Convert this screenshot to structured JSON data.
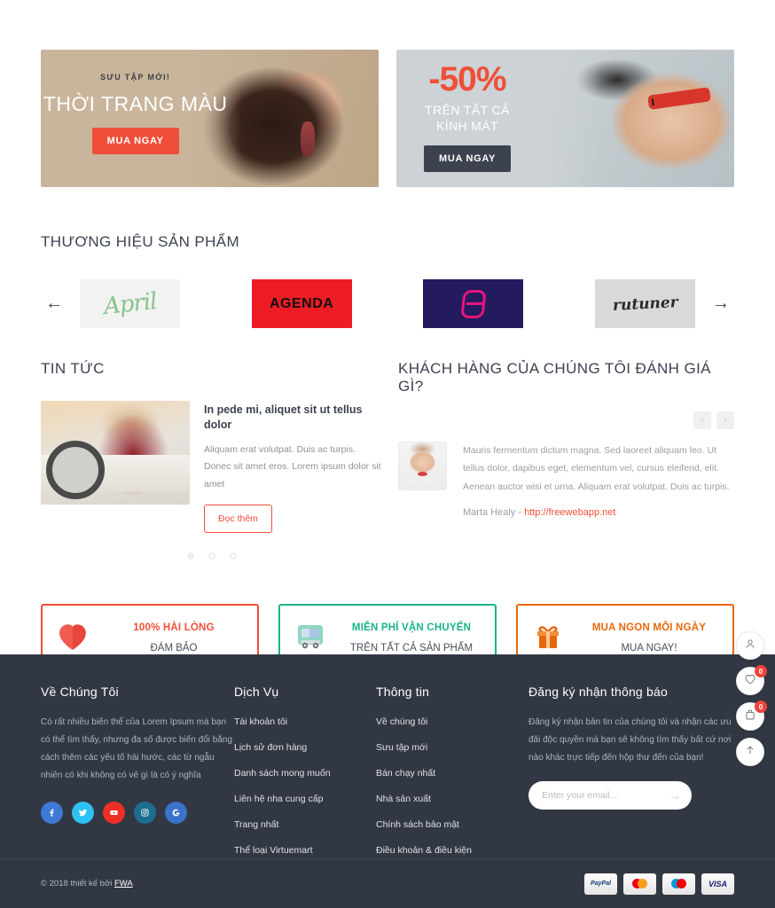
{
  "banners": [
    {
      "kicker": "SƯU TẬP MỚI!",
      "title": "THỜI TRANG MÀU",
      "button": "MUA NGAY"
    },
    {
      "discount": "-50%",
      "sub_line1": "TRÊN TẤT CẢ",
      "sub_line2": "KÍNH MÁT",
      "button": "MUA NGAY"
    }
  ],
  "brands": {
    "title": "THƯƠNG HIỆU SẢN PHẨM",
    "prev": "←",
    "next": "→",
    "items": [
      {
        "name": "April",
        "mark": "April"
      },
      {
        "name": "Agenda",
        "mark": "AGENDA"
      },
      {
        "name": "S-Logo",
        "mark": ""
      },
      {
        "name": "rutuner",
        "mark": "rutuner"
      }
    ]
  },
  "news": {
    "title": "TIN TỨC",
    "post": {
      "title": "In pede mi, aliquet sit ut tellus dolor",
      "excerpt": "Aliquam erat volutpat. Duis ac turpis. Donec sit amet eros. Lorem ipsum dolor sit amet",
      "button": "Đọc thêm"
    },
    "dots": [
      "active",
      "inactive",
      "inactive"
    ]
  },
  "testimonials": {
    "title": "KHÁCH HÀNG CỦA CHÚNG TÔI ĐÁNH GIÁ GÌ?",
    "prev": "‹",
    "next": "›",
    "quote": "Mauris fermentum dictum magna. Sed laoreet aliquam leo. Ut tellus dolor, dapibus eget, elementum vel, cursus eleifend, elit. Aenean auctor wisi et urna. Aliquam erat volutpat. Duis ac turpis.",
    "author": "Marta Healy - ",
    "link": "http://freewebapp.net"
  },
  "features": [
    {
      "top": "100% HÀI LÒNG",
      "bottom": "ĐÁM BẢO",
      "icon": "heart-icon",
      "color": "#ef4f38"
    },
    {
      "top": "MIỄN PHÍ VẬN CHUYỂN",
      "bottom": "TRÊN TẤT CẢ SẢN PHẨM",
      "icon": "truck-icon",
      "color": "#16b48a"
    },
    {
      "top": "MUA NGON MỖI NGÀY",
      "bottom": "MUA NGAY!",
      "icon": "gift-icon",
      "color": "#e8670c"
    }
  ],
  "footer": {
    "about": {
      "title": "Về Chúng Tôi",
      "text": "Có rất nhiều biến thể của Lorem Ipsum mà bạn có thể tìm thấy, nhưng đa số được biến đổi bằng cách thêm các yếu tố hài hước, các từ ngẫu nhiên có khi không có vẻ gì là có ý nghĩa",
      "socials": [
        "facebook-icon",
        "twitter-icon",
        "youtube-icon",
        "instagram-icon",
        "googleplus-icon"
      ]
    },
    "services": {
      "title": "Dịch Vụ",
      "items": [
        "Tài khoản tôi",
        "Lịch sử đơn hàng",
        "Danh sách mong muốn",
        "Liên hệ nha cung cấp",
        "Trang nhất",
        "Thể loại Virtuemart"
      ]
    },
    "info": {
      "title": "Thông tin",
      "items": [
        "Về chúng tôi",
        "Sưu tập mới",
        "Bán chạy nhất",
        "Nhà sản xuất",
        "Chính sách bảo mật",
        "Điều khoản & điều kiện"
      ]
    },
    "newsletter": {
      "title": "Đăng ký nhận thông báo",
      "text": "Đăng ký nhận bản tin của chúng tôi và nhận các ưu đãi độc quyền mà bạn sẽ không tìm thấy bất cứ nơi nào khác trực tiếp đến hộp thư đến của bạn!",
      "placeholder": "Enter your email...",
      "submit": "→"
    },
    "bottom": {
      "copyright_prefix": "© 2018 thiết kế bởi ",
      "copyright_link": "FWA",
      "payments": [
        "PayPal",
        "MasterCard",
        "Maestro",
        "VISA"
      ]
    }
  },
  "side_buttons": [
    {
      "name": "account-button",
      "icon": "user-icon",
      "badge": ""
    },
    {
      "name": "wishlist-button",
      "icon": "heart-icon",
      "badge": "0"
    },
    {
      "name": "cart-button",
      "icon": "bag-icon",
      "badge": "0"
    },
    {
      "name": "scroll-top-button",
      "icon": "arrow-up-icon",
      "badge": ""
    }
  ]
}
